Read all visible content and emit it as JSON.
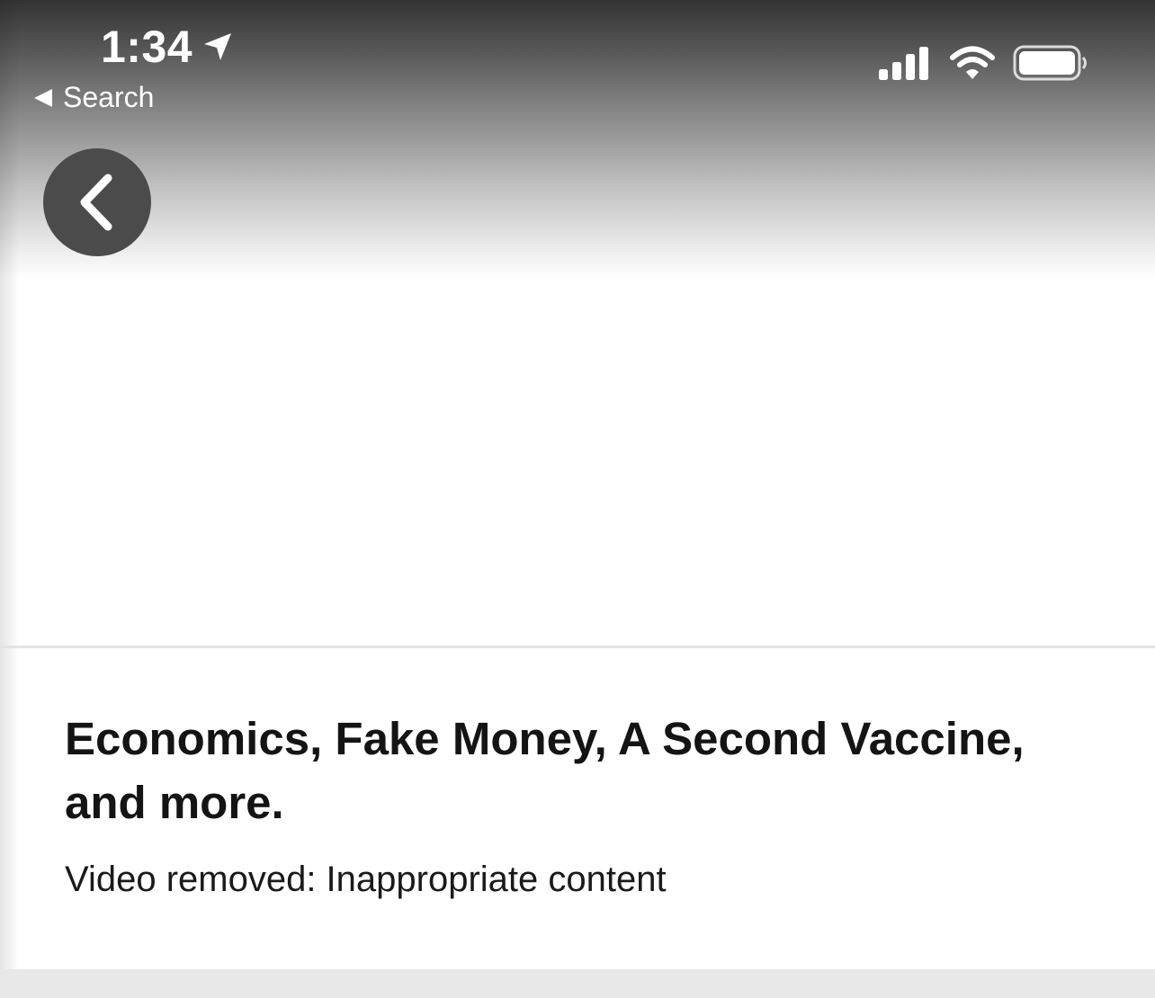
{
  "status_bar": {
    "time": "1:34",
    "location_icon": "location-arrow-icon",
    "signal_icon": "cellular-signal-icon",
    "wifi_icon": "wifi-icon",
    "battery_icon": "battery-icon"
  },
  "nav": {
    "back_to_app_label": "Search",
    "back_to_app_icon": "back-triangle-icon",
    "back_button_icon": "chevron-left-icon"
  },
  "video": {
    "title": "Economics, Fake Money, A Second Vaccine, and more.",
    "status_message": "Video removed: Inappropriate content"
  },
  "colors": {
    "header_gradient_top": "#333333",
    "back_button_bg": "#4b4b4b",
    "title_text": "#141414",
    "divider": "#e2e2e2",
    "bottom_band": "#e8e8e8"
  }
}
